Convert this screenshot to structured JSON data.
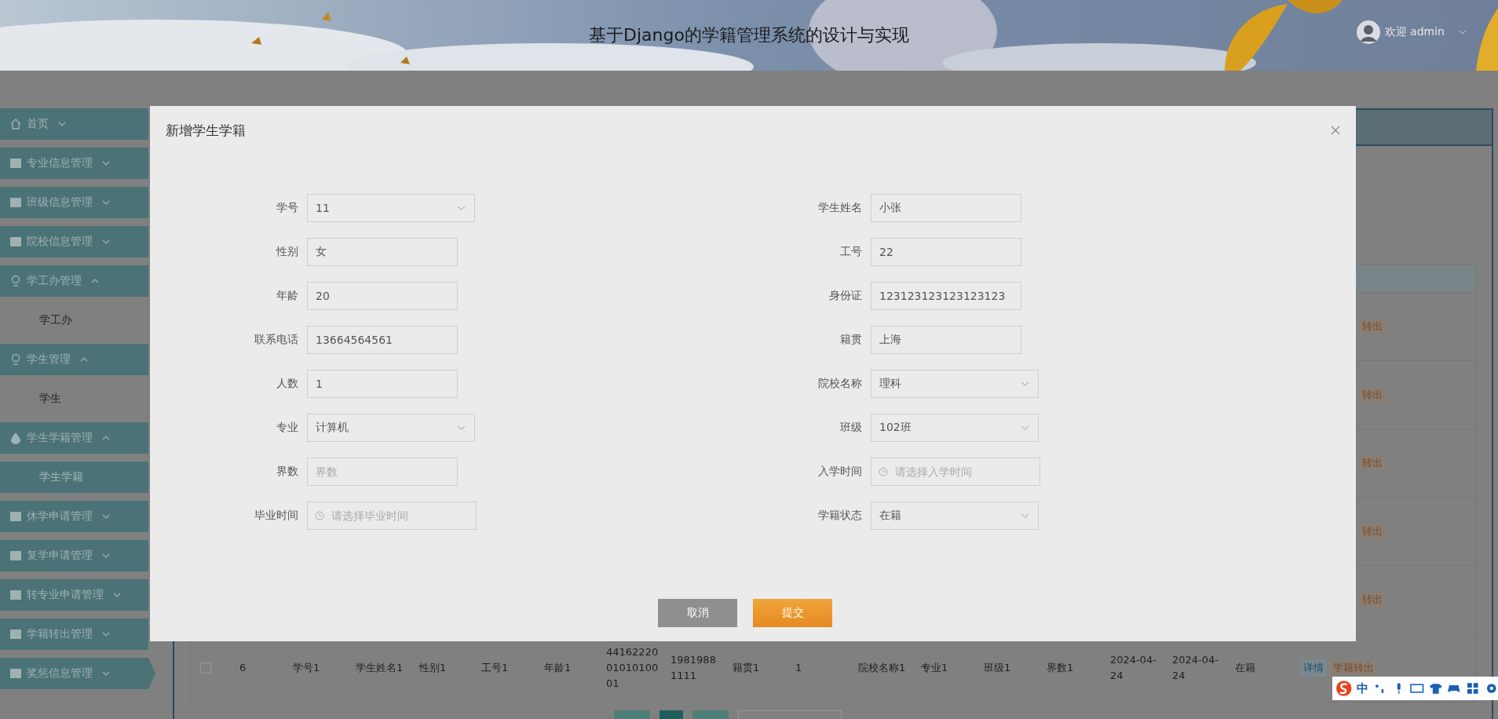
{
  "header": {
    "title": "基于Django的学籍管理系统的设计与实现",
    "user": "欢迎 admin"
  },
  "sidebar": [
    {
      "label": "首页",
      "expanded": false
    },
    {
      "label": "专业信息管理",
      "expanded": false
    },
    {
      "label": "班级信息管理",
      "expanded": false
    },
    {
      "label": "院校信息管理",
      "expanded": false
    },
    {
      "label": "学工办管理",
      "expanded": true,
      "children": [
        {
          "label": "学工办",
          "selected": false
        }
      ]
    },
    {
      "label": "学生管理",
      "expanded": true,
      "children": [
        {
          "label": "学生",
          "selected": false
        }
      ]
    },
    {
      "label": "学生学籍管理",
      "expanded": true,
      "children": [
        {
          "label": "学生学籍",
          "selected": true
        }
      ]
    },
    {
      "label": "休学申请管理",
      "expanded": false
    },
    {
      "label": "复学申请管理",
      "expanded": false
    },
    {
      "label": "转专业申请管理",
      "expanded": false
    },
    {
      "label": "学籍转出管理",
      "expanded": false
    },
    {
      "label": "奖惩信息管理",
      "expanded": false
    }
  ],
  "table": {
    "hidden_rows": [
      {
        "action": "转出"
      },
      {
        "action": "转出"
      },
      {
        "action": "转出"
      },
      {
        "action": "转出"
      },
      {
        "action": "转出"
      }
    ],
    "rows": [
      {
        "checked": false,
        "cells": [
          "6",
          "学号1",
          "学生姓名1",
          "性别1",
          "工号1",
          "年龄1",
          "441622200101010001",
          "19819881111",
          "籍贯1",
          "1",
          "院校名称1",
          "专业1",
          "班级1",
          "界数1",
          "2024-04-24",
          "2024-04-24",
          "在籍"
        ],
        "detail": "详情",
        "action": "学籍转出"
      }
    ]
  },
  "dialog": {
    "title": "新增学生学籍",
    "left_fields": [
      {
        "kind": "select",
        "label": "学号",
        "value": "11"
      },
      {
        "kind": "input",
        "label": "性别",
        "value": "女"
      },
      {
        "kind": "input",
        "label": "年龄",
        "value": "20"
      },
      {
        "kind": "input",
        "label": "联系电话",
        "value": "13664564561"
      },
      {
        "kind": "input",
        "label": "人数",
        "value": "1"
      },
      {
        "kind": "select",
        "label": "专业",
        "value": "计算机"
      },
      {
        "kind": "input",
        "label": "界数",
        "placeholder": "界数"
      },
      {
        "kind": "date",
        "label": "毕业时间",
        "placeholder": "请选择毕业时间"
      }
    ],
    "right_fields": [
      {
        "kind": "input",
        "label": "学生姓名",
        "value": "小张"
      },
      {
        "kind": "input",
        "label": "工号",
        "value": "22"
      },
      {
        "kind": "input",
        "label": "身份证",
        "value": "123123123123123123"
      },
      {
        "kind": "input",
        "label": "籍贯",
        "value": "上海"
      },
      {
        "kind": "select",
        "label": "院校名称",
        "value": "理科"
      },
      {
        "kind": "select",
        "label": "班级",
        "value": "102班"
      },
      {
        "kind": "date",
        "label": "入学时间",
        "placeholder": "请选择入学时间"
      },
      {
        "kind": "select",
        "label": "学籍状态",
        "value": "在籍"
      }
    ],
    "buttons": [
      {
        "kind": "cancel",
        "label": "取消"
      },
      {
        "kind": "submit",
        "label": "提交"
      }
    ]
  },
  "ime": {
    "mode": "中"
  }
}
